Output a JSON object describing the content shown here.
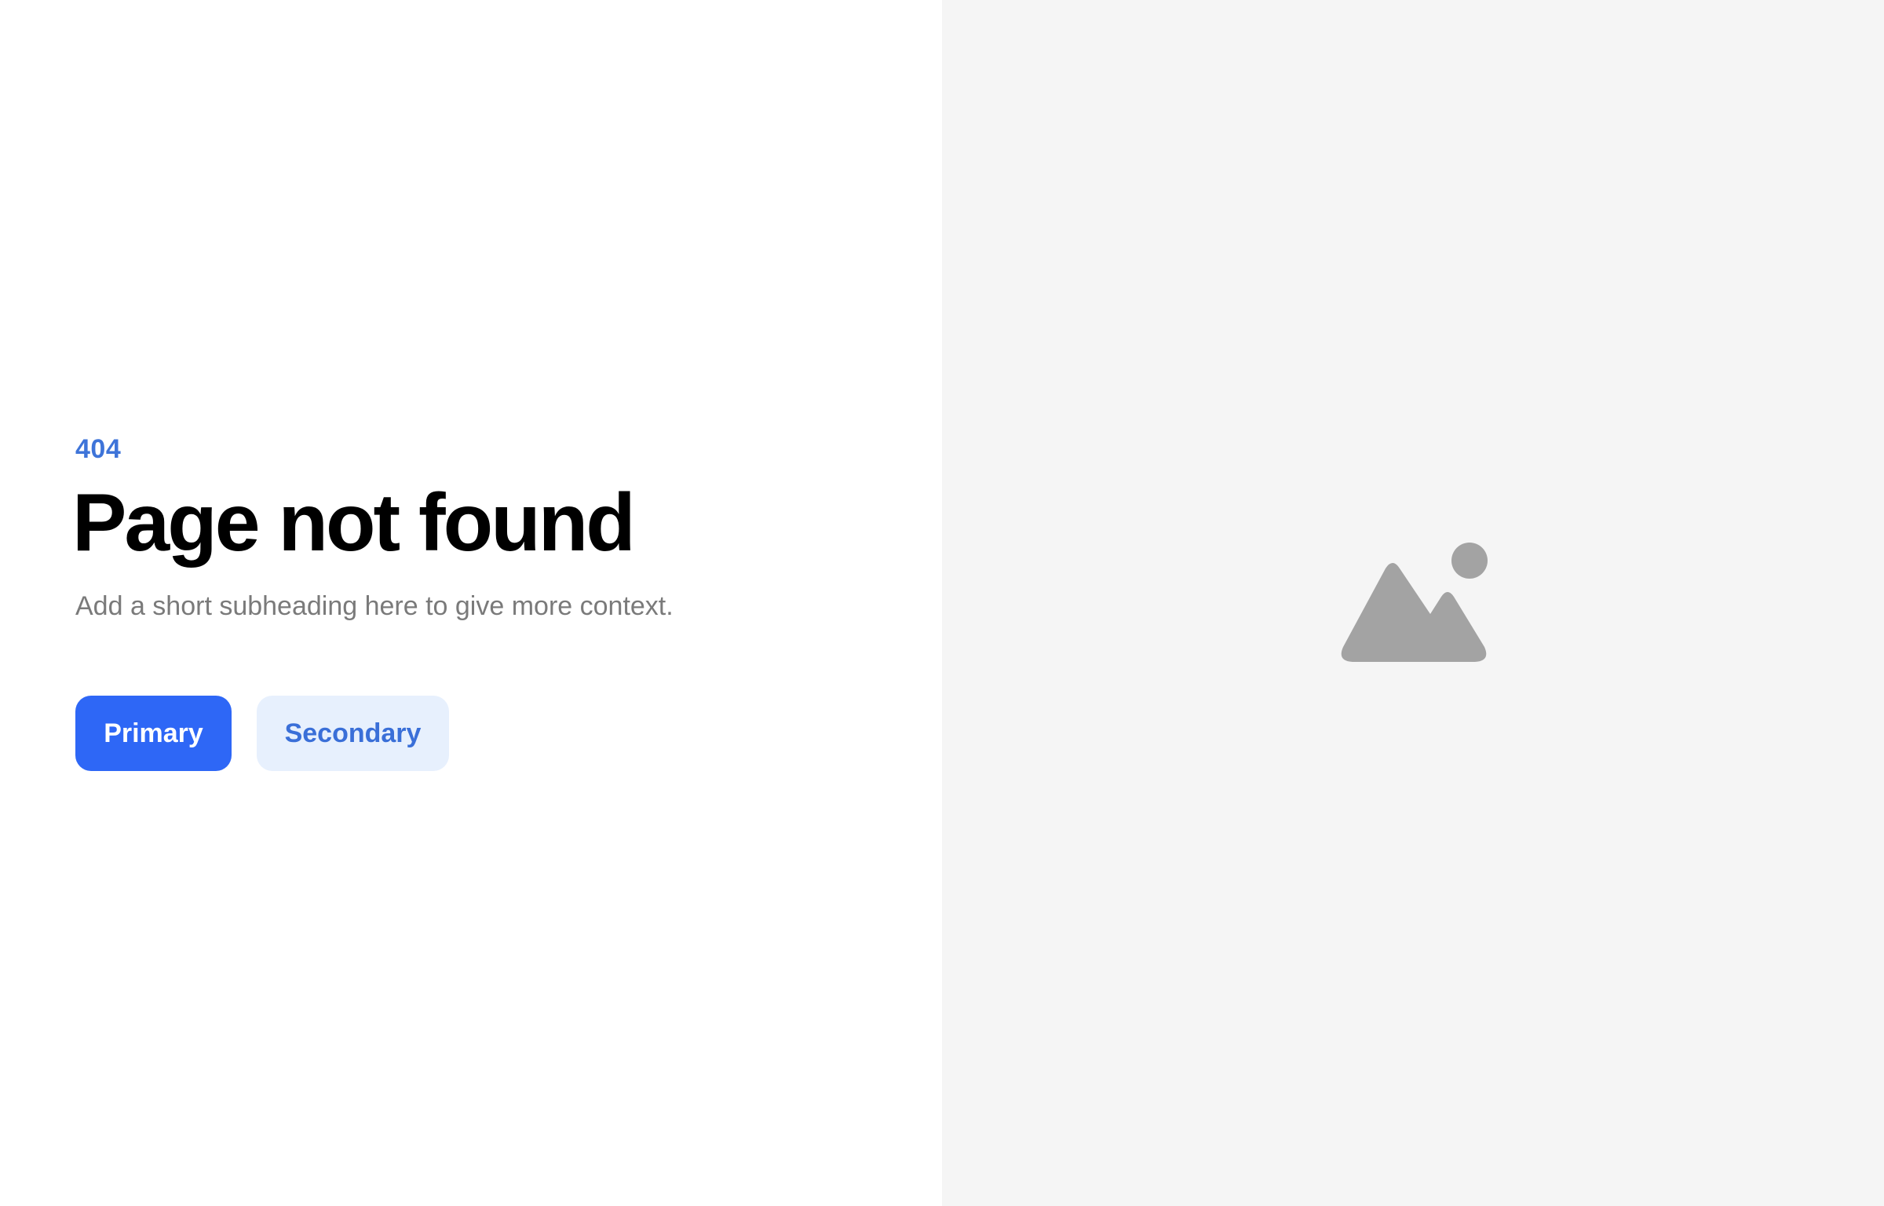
{
  "error": {
    "code": "404",
    "title": "Page not found",
    "subheading": "Add a short subheading here to give more context."
  },
  "actions": {
    "primary_label": "Primary",
    "secondary_label": "Secondary"
  },
  "illustration": {
    "icon": "image-placeholder-icon"
  },
  "colors": {
    "accent": "#2e67f6",
    "accent_text": "#3e74d9",
    "secondary_bg": "#e7f0fd",
    "muted_text": "#7a7a7a",
    "panel_bg": "#f5f5f5",
    "icon_gray": "#a3a3a3"
  }
}
